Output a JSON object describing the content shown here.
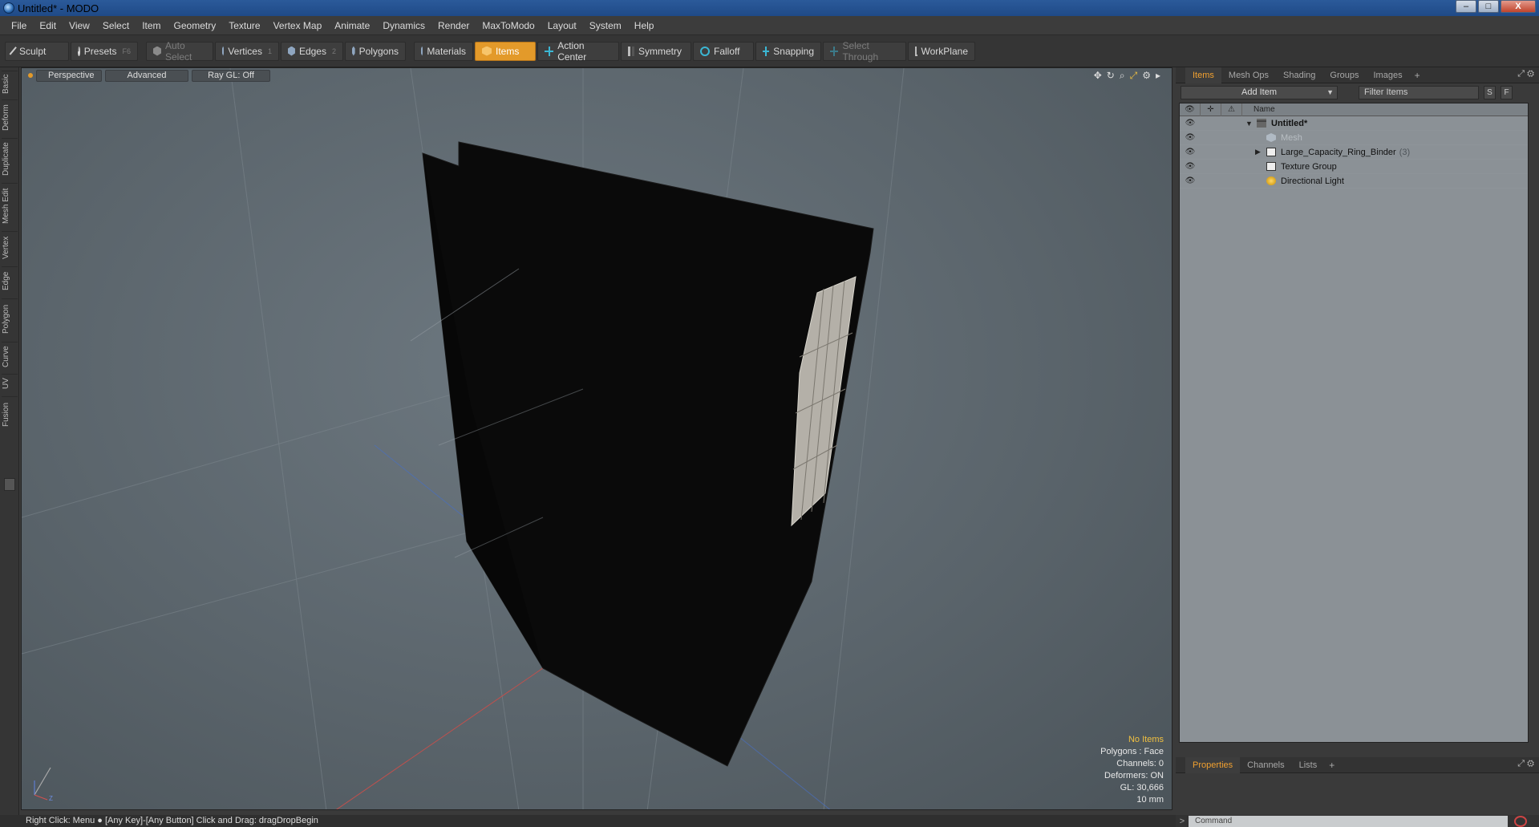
{
  "window": {
    "title": "Untitled* - MODO",
    "minimize": "–",
    "maximize": "□",
    "close": "X"
  },
  "menus": [
    "File",
    "Edit",
    "View",
    "Select",
    "Item",
    "Geometry",
    "Texture",
    "Vertex Map",
    "Animate",
    "Dynamics",
    "Render",
    "MaxToModo",
    "Layout",
    "System",
    "Help"
  ],
  "toolbar": {
    "sculpt": "Sculpt",
    "presets": "Presets",
    "presets_hotkey": "F6",
    "auto_select": "Auto Select",
    "vertices": "Vertices",
    "vertices_hotkey": "1",
    "edges": "Edges",
    "edges_hotkey": "2",
    "polygons": "Polygons",
    "materials": "Materials",
    "items": "Items",
    "action_center": "Action Center",
    "symmetry": "Symmetry",
    "falloff": "Falloff",
    "snapping": "Snapping",
    "select_through": "Select Through",
    "workplane": "WorkPlane",
    "accent_color": "#e39a2a"
  },
  "left_tabs": [
    "Basic",
    "Deform",
    "Duplicate",
    "Mesh Edit",
    "Vertex",
    "Edge",
    "Polygon",
    "Curve",
    "UV",
    "Fusion"
  ],
  "viewport": {
    "view_mode": "Perspective",
    "shading": "Advanced",
    "raygl": "Ray GL: Off",
    "info": {
      "selection": "No Items",
      "polygons": "Polygons : Face",
      "channels": "Channels: 0",
      "deformers": "Deformers: ON",
      "gl": "GL: 30,666",
      "scale": "10 mm"
    },
    "axis_labels": {
      "y": "Y",
      "x": "X",
      "z": "Z"
    }
  },
  "items_panel": {
    "tabs": [
      "Items",
      "Mesh Ops",
      "Shading",
      "Groups",
      "Images"
    ],
    "active_tab": "Items",
    "add_item": "Add Item",
    "filter_placeholder": "Filter Items",
    "btn_s": "S",
    "btn_f": "F",
    "column_name": "Name",
    "rows": [
      {
        "label": "Untitled*",
        "count": ""
      },
      {
        "label": "Mesh",
        "count": ""
      },
      {
        "label": "Large_Capacity_Ring_Binder",
        "count": "(3)"
      },
      {
        "label": "Texture Group",
        "count": ""
      },
      {
        "label": "Directional Light",
        "count": ""
      }
    ]
  },
  "properties_panel": {
    "tabs": [
      "Properties",
      "Channels",
      "Lists"
    ],
    "active_tab": "Properties"
  },
  "command": {
    "placeholder": "Command",
    "prompt": ">"
  },
  "status": {
    "text": "Right Click: Menu ●  [Any Key]-[Any Button] Click and Drag: dragDropBegin"
  }
}
